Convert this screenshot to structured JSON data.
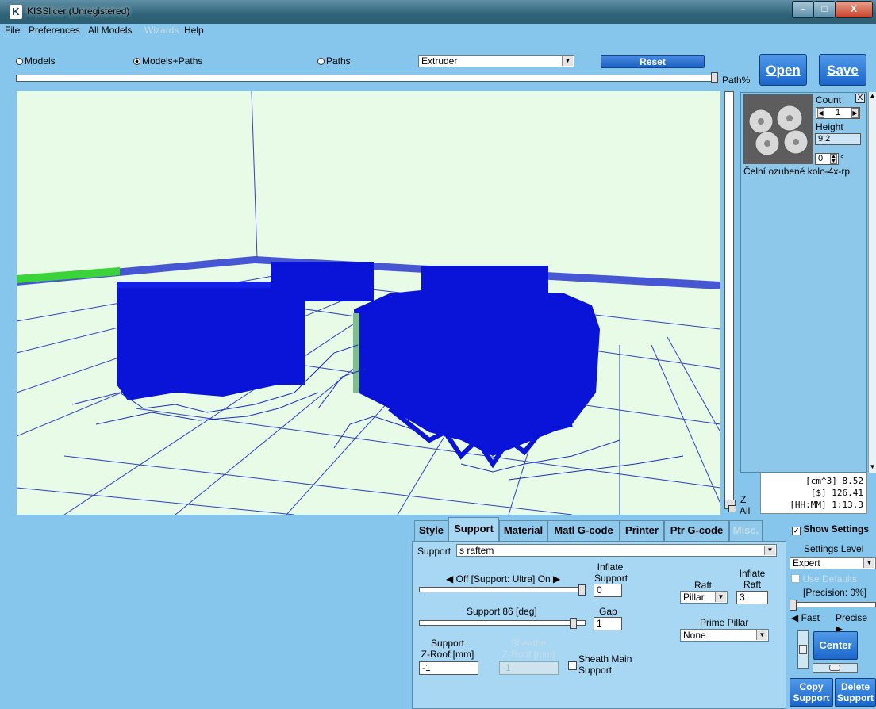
{
  "window": {
    "title": "KISSlicer (Unregistered)",
    "app_icon_glyph": "K",
    "minimize_glyph": "–",
    "maximize_glyph": "□",
    "close_glyph": "X"
  },
  "menu": {
    "items": [
      "File",
      "Preferences",
      "All Models",
      "Wizards",
      "Help"
    ],
    "disabled": [
      "Wizards"
    ]
  },
  "view_modes": {
    "options": [
      "Models",
      "Models+Paths",
      "Paths"
    ],
    "selected": "Models+Paths"
  },
  "extruder_select": {
    "value": "Extruder"
  },
  "toolbar": {
    "reset_label": "Reset",
    "open_label": "Open",
    "save_label": "Save"
  },
  "path_slider": {
    "label": "Path%",
    "fraction": 1.0
  },
  "z_slider": {
    "z_label": "Z",
    "all_label": "All"
  },
  "model_card": {
    "count_label": "Count",
    "count_value": "1",
    "height_label": "Height",
    "height_value": "9.2",
    "rotation_value": "0",
    "rotation_unit": "°",
    "name": "Čelní ozubené kolo-4x-rp",
    "remove_label": "X"
  },
  "stats": {
    "volume": "[cm^3] 8.52",
    "cost": "[$] 126.41",
    "time": "[HH:MM] 1:13.3"
  },
  "tabs": {
    "items": [
      "Style",
      "Support",
      "Material",
      "Matl G-code",
      "Printer",
      "Ptr G-code",
      "Misc."
    ],
    "active": "Support",
    "disabled": [
      "Misc."
    ]
  },
  "support_settings": {
    "support_label": "Support",
    "support_profile": "s raftem",
    "support_level_label": "◀ Off [Support: Ultra] On ▶",
    "inflate_support_label_1": "Inflate",
    "inflate_support_label_2": "Support",
    "inflate_support_value": "0",
    "support_angle_label": "Support 86 [deg]",
    "gap_label": "Gap",
    "gap_value": "1",
    "z_roof_label_1": "Support",
    "z_roof_label_2": "Z-Roof [mm]",
    "z_roof_value": "-1",
    "sheathe_label_1": "Sheathe",
    "sheathe_label_2": "Z-Roof [mm]",
    "sheathe_value": "-1",
    "sheath_main_label_1": "Sheath Main",
    "sheath_main_label_2": "Support",
    "raft_label": "Raft",
    "raft_value": "Pillar",
    "inflate_raft_label_1": "Inflate",
    "inflate_raft_label_2": "Raft",
    "inflate_raft_value": "3",
    "prime_pillar_label": "Prime Pillar",
    "prime_pillar_value": "None"
  },
  "side_settings": {
    "show_settings_label": "Show Settings",
    "show_settings_checked": true,
    "settings_level_label": "Settings Level",
    "settings_level_value": "Expert",
    "use_defaults_label": "Use Defaults",
    "precision_label": "[Precision: 0%]",
    "fast_label": "◀ Fast",
    "precise_label": "Precise ▶",
    "center_label": "Center",
    "copy_support_label_1": "Copy",
    "copy_support_label_2": "Support",
    "delete_support_label_1": "Delete",
    "delete_support_label_2": "Support"
  },
  "colors": {
    "background": "#87c6ec",
    "viewport_bg": "#e8fbe6",
    "toolpath_blue": "#0a14d8",
    "grid_line": "#1a2cc8",
    "bed_green_edge": "#3ad43a",
    "button_blue": "#1b66cc"
  }
}
